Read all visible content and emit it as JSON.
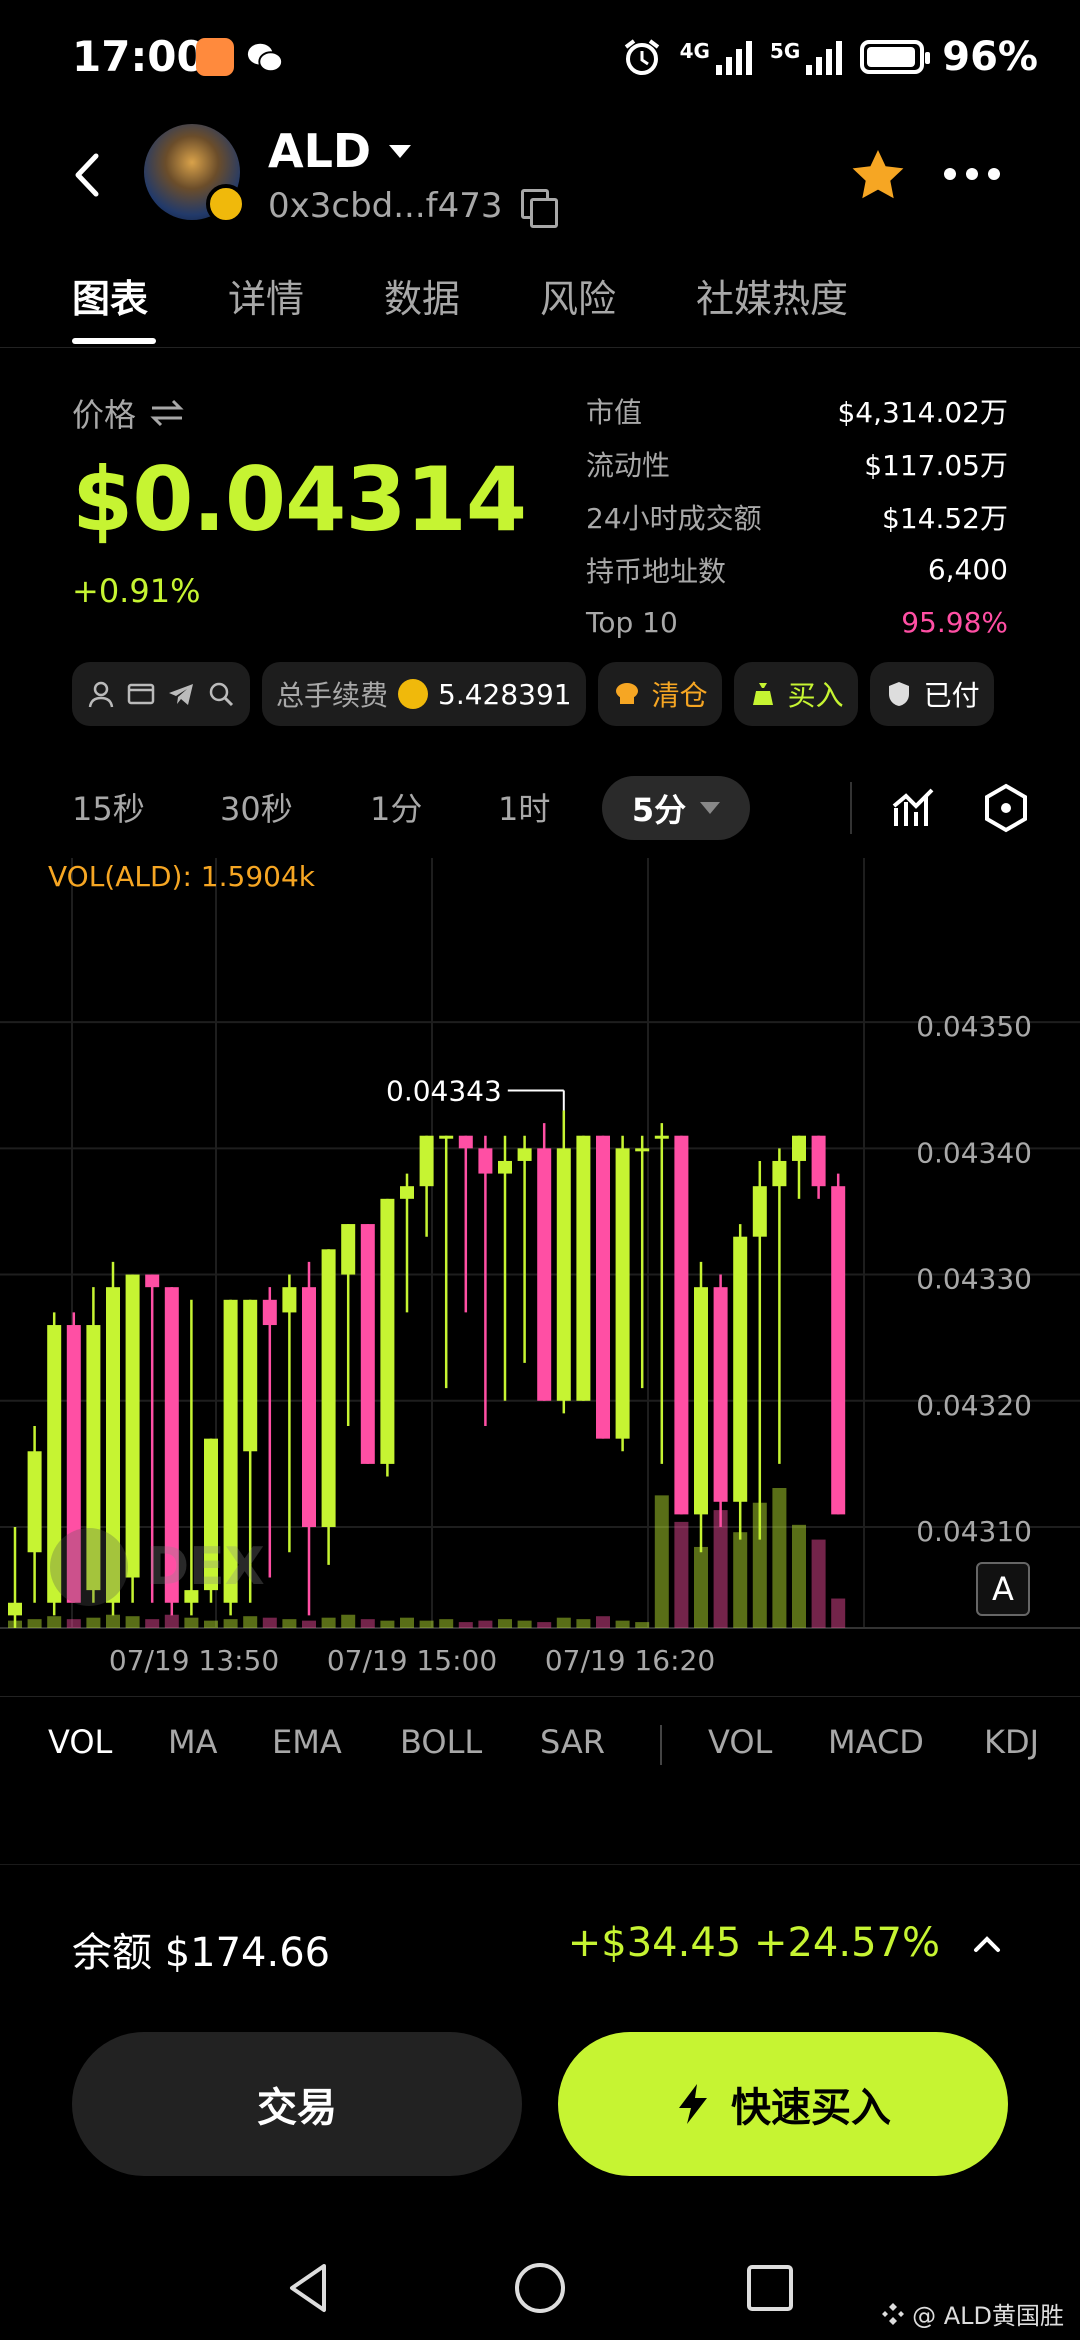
{
  "status_bar": {
    "time": "17:00",
    "net1": "4G",
    "net2": "5G",
    "battery": "96%"
  },
  "header": {
    "token_name": "ALD",
    "address": "0x3cbd...f473"
  },
  "tabs": [
    {
      "label": "图表",
      "active": true
    },
    {
      "label": "详情"
    },
    {
      "label": "数据"
    },
    {
      "label": "风险"
    },
    {
      "label": "社媒热度"
    }
  ],
  "price": {
    "label": "价格",
    "value": "$0.04314",
    "change": "+0.91%"
  },
  "stats": [
    {
      "key": "市值",
      "value": "$4,314.02万"
    },
    {
      "key": "流动性",
      "value": "$117.05万"
    },
    {
      "key": "24小时成交额",
      "value": "$14.52万"
    },
    {
      "key": "持币地址数",
      "value": "6,400"
    },
    {
      "key": "Top 10",
      "value": "95.98%"
    }
  ],
  "chips": {
    "fee_label": "总手续费",
    "fee_value": "5.428391",
    "clear_label": "清仓",
    "buy_label": "买入",
    "paid_label": "已付"
  },
  "intervals": [
    "15秒",
    "30秒",
    "1分",
    "1时"
  ],
  "interval_active": "5分",
  "chart_data": {
    "type": "candlestick",
    "volume_label": "VOL(ALD): 1.5904k",
    "y_ticks": [
      "0.04350",
      "0.04340",
      "0.04330",
      "0.04320",
      "0.04310"
    ],
    "ylim": [
      0.04302,
      0.04363
    ],
    "x_ticks": [
      "07/19 13:50",
      "07/19 15:00",
      "07/19 16:20"
    ],
    "max_label": "0.04343",
    "watermark": "DEX",
    "candles": [
      {
        "o": 0.04303,
        "h": 0.0431,
        "l": 0.04302,
        "c": 0.04304
      },
      {
        "o": 0.04308,
        "h": 0.04318,
        "l": 0.04304,
        "c": 0.04316
      },
      {
        "o": 0.04304,
        "h": 0.04327,
        "l": 0.04303,
        "c": 0.04326
      },
      {
        "o": 0.04326,
        "h": 0.04327,
        "l": 0.04304,
        "c": 0.04304
      },
      {
        "o": 0.04305,
        "h": 0.04329,
        "l": 0.04304,
        "c": 0.04326
      },
      {
        "o": 0.04304,
        "h": 0.04331,
        "l": 0.04303,
        "c": 0.04329
      },
      {
        "o": 0.04306,
        "h": 0.0433,
        "l": 0.04304,
        "c": 0.0433
      },
      {
        "o": 0.0433,
        "h": 0.0433,
        "l": 0.04304,
        "c": 0.04329
      },
      {
        "o": 0.04329,
        "h": 0.04329,
        "l": 0.04303,
        "c": 0.04304
      },
      {
        "o": 0.04304,
        "h": 0.04328,
        "l": 0.04303,
        "c": 0.04305
      },
      {
        "o": 0.04305,
        "h": 0.04317,
        "l": 0.04304,
        "c": 0.04317
      },
      {
        "o": 0.04304,
        "h": 0.04328,
        "l": 0.04303,
        "c": 0.04328
      },
      {
        "o": 0.04316,
        "h": 0.04328,
        "l": 0.04304,
        "c": 0.04328
      },
      {
        "o": 0.04328,
        "h": 0.04329,
        "l": 0.04306,
        "c": 0.04326
      },
      {
        "o": 0.04327,
        "h": 0.0433,
        "l": 0.04308,
        "c": 0.04329
      },
      {
        "o": 0.04329,
        "h": 0.04331,
        "l": 0.04303,
        "c": 0.0431
      },
      {
        "o": 0.0431,
        "h": 0.04332,
        "l": 0.04307,
        "c": 0.04332
      },
      {
        "o": 0.0433,
        "h": 0.04334,
        "l": 0.04318,
        "c": 0.04334
      },
      {
        "o": 0.04334,
        "h": 0.04334,
        "l": 0.04315,
        "c": 0.04315
      },
      {
        "o": 0.04315,
        "h": 0.04336,
        "l": 0.04314,
        "c": 0.04336
      },
      {
        "o": 0.04336,
        "h": 0.04338,
        "l": 0.04327,
        "c": 0.04337
      },
      {
        "o": 0.04337,
        "h": 0.04341,
        "l": 0.04333,
        "c": 0.04341
      },
      {
        "o": 0.04341,
        "h": 0.04341,
        "l": 0.04321,
        "c": 0.04341
      },
      {
        "o": 0.04341,
        "h": 0.04341,
        "l": 0.04327,
        "c": 0.0434
      },
      {
        "o": 0.0434,
        "h": 0.04341,
        "l": 0.04318,
        "c": 0.04338
      },
      {
        "o": 0.04338,
        "h": 0.04341,
        "l": 0.0432,
        "c": 0.04339
      },
      {
        "o": 0.04339,
        "h": 0.04341,
        "l": 0.04323,
        "c": 0.0434
      },
      {
        "o": 0.0434,
        "h": 0.04342,
        "l": 0.0432,
        "c": 0.0432
      },
      {
        "o": 0.0432,
        "h": 0.04343,
        "l": 0.04319,
        "c": 0.0434
      },
      {
        "o": 0.0432,
        "h": 0.04341,
        "l": 0.0432,
        "c": 0.04341
      },
      {
        "o": 0.04341,
        "h": 0.04341,
        "l": 0.04317,
        "c": 0.04317
      },
      {
        "o": 0.04317,
        "h": 0.04341,
        "l": 0.04316,
        "c": 0.0434
      },
      {
        "o": 0.0434,
        "h": 0.04341,
        "l": 0.04321,
        "c": 0.0434
      },
      {
        "o": 0.04341,
        "h": 0.04342,
        "l": 0.04315,
        "c": 0.04341
      },
      {
        "o": 0.04341,
        "h": 0.04341,
        "l": 0.04311,
        "c": 0.04311
      },
      {
        "o": 0.04311,
        "h": 0.04331,
        "l": 0.04308,
        "c": 0.04329
      },
      {
        "o": 0.04329,
        "h": 0.0433,
        "l": 0.0431,
        "c": 0.04312
      },
      {
        "o": 0.04312,
        "h": 0.04334,
        "l": 0.04309,
        "c": 0.04333
      },
      {
        "o": 0.04333,
        "h": 0.04339,
        "l": 0.04309,
        "c": 0.04337
      },
      {
        "o": 0.04337,
        "h": 0.0434,
        "l": 0.04315,
        "c": 0.04339
      },
      {
        "o": 0.04339,
        "h": 0.04341,
        "l": 0.04336,
        "c": 0.04341
      },
      {
        "o": 0.04341,
        "h": 0.04341,
        "l": 0.04336,
        "c": 0.04337
      },
      {
        "o": 0.04337,
        "h": 0.04338,
        "l": 0.04311,
        "c": 0.04311
      }
    ],
    "volumes": [
      0.05,
      0.06,
      0.08,
      0.06,
      0.07,
      0.09,
      0.08,
      0.06,
      0.09,
      0.07,
      0.05,
      0.06,
      0.08,
      0.07,
      0.06,
      0.05,
      0.07,
      0.09,
      0.06,
      0.05,
      0.07,
      0.05,
      0.06,
      0.04,
      0.05,
      0.06,
      0.05,
      0.04,
      0.07,
      0.06,
      0.08,
      0.05,
      0.04,
      0.9,
      0.72,
      0.55,
      0.8,
      0.65,
      0.85,
      0.95,
      0.7,
      0.6,
      0.2
    ]
  },
  "indicators_main": [
    "VOL",
    "MA",
    "EMA",
    "BOLL",
    "SAR"
  ],
  "indicators_sub": [
    "VOL",
    "MACD",
    "KDJ"
  ],
  "balance": {
    "label": "余额 $174.66",
    "pnl": "+$34.45 +24.57%"
  },
  "buttons": {
    "trade": "交易",
    "quick_buy": "快速买入"
  },
  "credit": "@ ALD黄国胜",
  "colors": {
    "up": "#c6f432",
    "down": "#ff4fa4",
    "accent": "#c6f432"
  }
}
